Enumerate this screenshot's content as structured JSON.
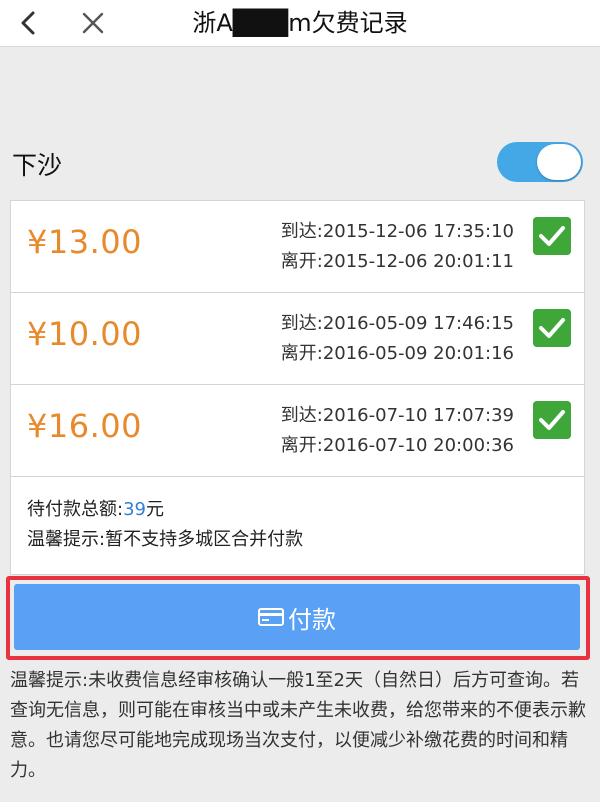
{
  "nav": {
    "back_icon": "chevron-left-icon",
    "close_icon": "close-icon",
    "title": "浙A███m欠费记录"
  },
  "area": {
    "name": "下沙",
    "toggle_on": true
  },
  "records": [
    {
      "amount": "¥13.00",
      "arrive": "到达:2015-12-06 17:35:10",
      "leave": "离开:2015-12-06 20:01:11",
      "checked": true
    },
    {
      "amount": "¥10.00",
      "arrive": "到达:2016-05-09 17:46:15",
      "leave": "离开:2016-05-09 20:01:16",
      "checked": true
    },
    {
      "amount": "¥16.00",
      "arrive": "到达:2016-07-10 17:07:39",
      "leave": "离开:2016-07-10 20:00:36",
      "checked": true
    }
  ],
  "summary": {
    "total_label": "待付款总额:",
    "total_value": "39",
    "total_unit": "元",
    "hint": "温馨提示:暂不支持多城区合并付款"
  },
  "pay": {
    "label": "付款",
    "icon": "card-icon"
  },
  "notice": "温馨提示:未收费信息经审核确认一般1至2天（自然日）后方可查询。若查询无信息，则可能在审核当中或未产生未收费，给您带来的不便表示歉意。也请您尽可能地完成现场当次支付，以便减少补缴花费的时间和精力。",
  "colors": {
    "amount": "#e8892b",
    "check": "#3fa63a",
    "toggle": "#44a7e6",
    "pay_button": "#5aa0f5",
    "highlight_frame": "#e8323f",
    "total_value": "#2f7fd4"
  }
}
